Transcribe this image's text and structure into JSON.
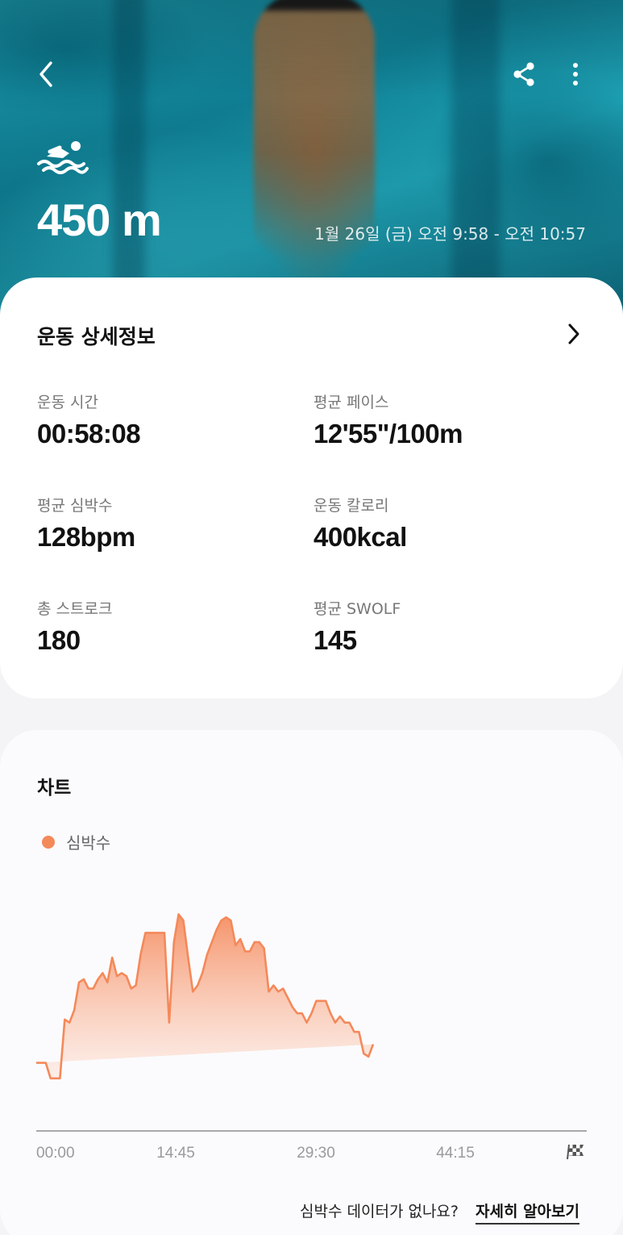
{
  "header": {
    "distance": "450 m",
    "time_range": "1월 26일 (금) 오전 9:58 - 오전 10:57",
    "icons": {
      "back": "chevron-left-icon",
      "share": "share-icon",
      "more": "more-vertical-icon",
      "activity": "swimming-icon"
    }
  },
  "details": {
    "title": "운동 상세정보",
    "stats": [
      {
        "label": "운동 시간",
        "value": "00:58:08"
      },
      {
        "label": "평균 페이스",
        "value": "12'55\"/100m"
      },
      {
        "label": "평균 심박수",
        "value": "128bpm"
      },
      {
        "label": "운동 칼로리",
        "value": "400kcal"
      },
      {
        "label": "총 스트로크",
        "value": "180"
      },
      {
        "label": "평균 SWOLF",
        "value": "145"
      }
    ]
  },
  "chart": {
    "title": "차트",
    "legend": "심박수",
    "finish_icon": "finish-flag-icon",
    "footer_question": "심박수 데이터가 없나요?",
    "footer_link": "자세히 알아보기"
  },
  "colors": {
    "accent": "#f4895a",
    "fill_top": "#f7a27a",
    "fill_bottom": "#fff3ee"
  },
  "chart_data": {
    "type": "area",
    "series": [
      {
        "name": "심박수"
      }
    ],
    "x_tick_labels": [
      "00:00",
      "14:45",
      "29:30",
      "44:15"
    ],
    "x": [
      0,
      1,
      1.5,
      2,
      2.5,
      3,
      3.5,
      4,
      4.5,
      5,
      5.5,
      6,
      6.5,
      7,
      7.5,
      8,
      8.5,
      9,
      9.5,
      10,
      10.5,
      11,
      11.5,
      12,
      12.5,
      13,
      13.5,
      14,
      14.5,
      15,
      15.5,
      16,
      16.5,
      17,
      17.5,
      18,
      18.5,
      19,
      19.5,
      20,
      20.5,
      21,
      21.5,
      22,
      22.5,
      23,
      23.5,
      24,
      24.5,
      25,
      25.5,
      26,
      26.5,
      27,
      27.5,
      28,
      28.5,
      29,
      29.5,
      30,
      30.5,
      31,
      31.5,
      32,
      32.5,
      33,
      33.5,
      34,
      34.5,
      35,
      35.5,
      36,
      36.5,
      37,
      37.5,
      38,
      38.5,
      39,
      39.5,
      40,
      40.5,
      41,
      41.5,
      42,
      42.5,
      43,
      43.5,
      44,
      44.5,
      45,
      45.5,
      46,
      46.5,
      47,
      47.5,
      48,
      48.5,
      49,
      49.5,
      50,
      50.5,
      51,
      51.5,
      52,
      52.5,
      53,
      53.5,
      54,
      54.5,
      55,
      55.5,
      56,
      56.5,
      57,
      57.5,
      58
    ],
    "values": [
      82,
      82,
      77,
      77,
      77,
      96,
      95,
      99,
      108,
      109,
      106,
      106,
      109,
      111,
      108,
      116,
      110,
      111,
      110,
      106,
      107,
      117,
      124,
      124,
      124,
      124,
      124,
      95,
      121,
      130,
      128,
      116,
      105,
      107,
      111,
      117,
      121,
      125,
      128,
      129,
      128,
      120,
      122,
      118,
      118,
      121,
      121,
      119,
      105,
      107,
      105,
      106,
      103,
      100,
      98,
      98,
      95,
      98,
      102,
      102,
      102,
      98,
      95,
      97,
      95,
      95,
      92,
      92,
      85,
      84,
      88
    ],
    "ylim": [
      60,
      140
    ],
    "xlim": [
      0,
      58
    ]
  }
}
